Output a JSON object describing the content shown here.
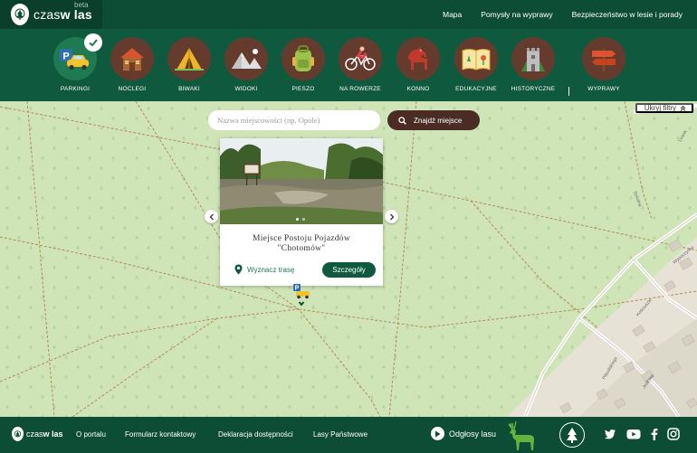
{
  "brand": {
    "name_light": "czas",
    "name_bold": "w las",
    "beta": "beta"
  },
  "nav": {
    "items": [
      "Mapa",
      "Pomysły na wyprawy",
      "Bezpieczeństwo w lesie i porady"
    ]
  },
  "categories": [
    {
      "label": "PARKINGI",
      "icon": "parking-icon",
      "active": true
    },
    {
      "label": "NOCLEGI",
      "icon": "cabin-icon",
      "active": false
    },
    {
      "label": "BIWAKI",
      "icon": "tent-icon",
      "active": false
    },
    {
      "label": "WIDOKI",
      "icon": "mountain-view-icon",
      "active": false
    },
    {
      "label": "PIESZO",
      "icon": "backpack-icon",
      "active": false
    },
    {
      "label": "NA ROWERZE",
      "icon": "cyclist-icon",
      "active": false
    },
    {
      "label": "KONNO",
      "icon": "horse-icon",
      "active": false
    },
    {
      "label": "EDUKACYJNE",
      "icon": "book-icon",
      "active": false
    },
    {
      "label": "HISTORYCZNE",
      "icon": "castle-icon",
      "active": false
    },
    {
      "label": "WYPRAWY",
      "icon": "signpost-icon",
      "active": false
    }
  ],
  "filters": {
    "toggle_label": "Ukryj filtry"
  },
  "search": {
    "placeholder": "Nazwa miejscowości (np. Opole)",
    "button_label": "Znajdź miejsce"
  },
  "popup": {
    "title_line1": "Miejsce Postoju Pojazdów",
    "title_line2": "\"Chotomów\"",
    "route_label": "Wyznacz trasę",
    "details_label": "Szczegóły",
    "slides": 2,
    "active_slide": 1
  },
  "map": {
    "street_labels": [
      "Lesna",
      "Szkolna",
      "Wypoczynku",
      "Kościuszki",
      "Piłsudskiego",
      "Jodłowa"
    ]
  },
  "footer": {
    "links": [
      "O portalu",
      "Formularz kontaktowy",
      "Deklaracja dostępności",
      "Lasy Państwowe"
    ],
    "sounds_label": "Odgłosy lasu",
    "social": [
      "twitter-icon",
      "youtube-icon",
      "facebook-icon",
      "instagram-icon"
    ]
  },
  "colors": {
    "primary": "#0e4d35",
    "category_circle": "#653b2e",
    "map_bg": "#cfe5b8",
    "accent": "#1f7a52"
  }
}
